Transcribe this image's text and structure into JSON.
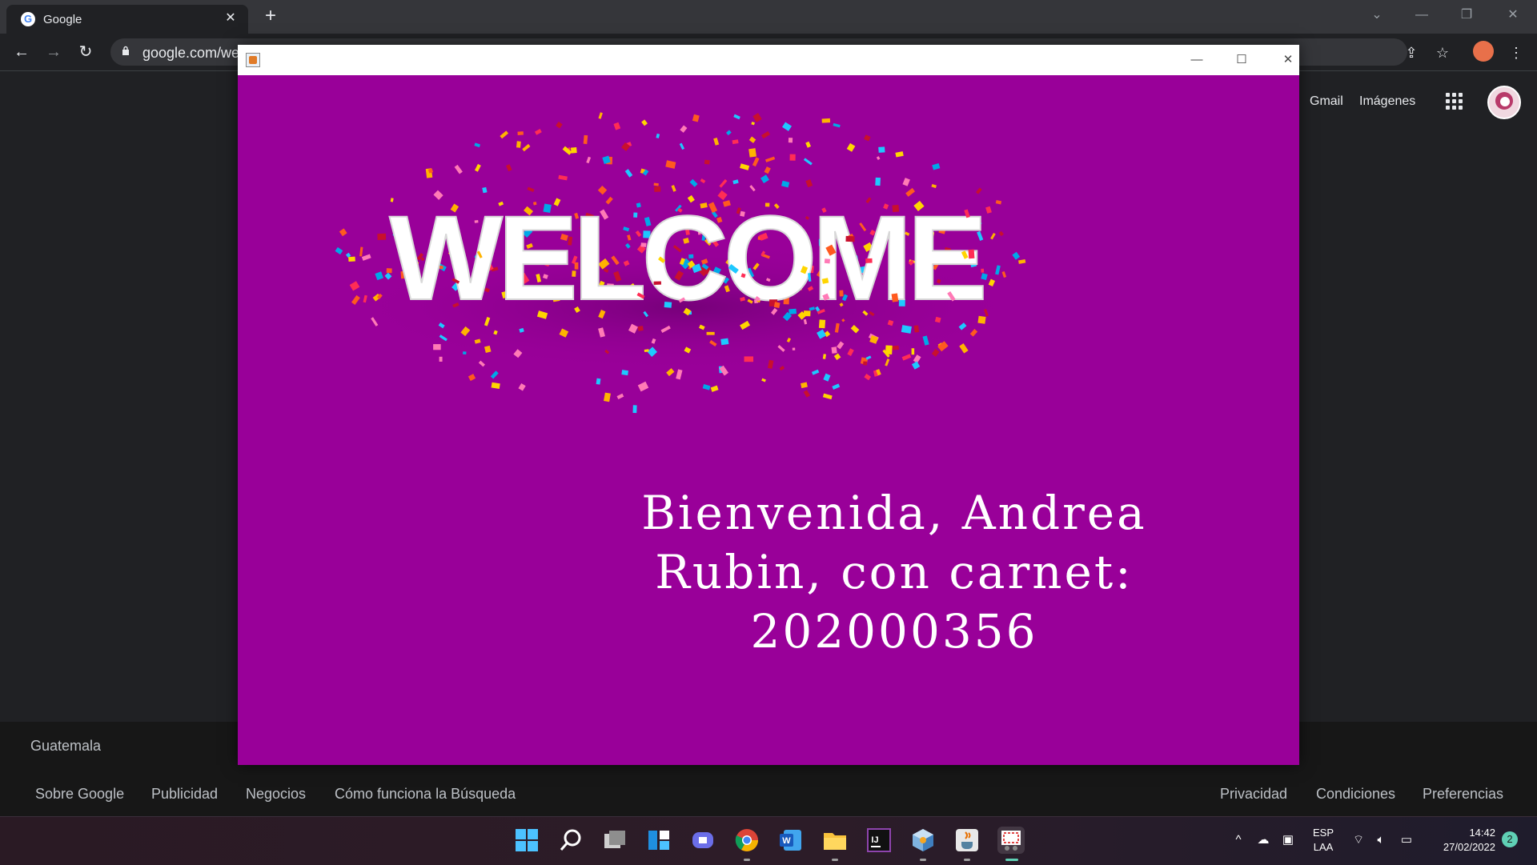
{
  "browser": {
    "tab_title": "Google",
    "url": "google.com/we",
    "new_tab_symbol": "+",
    "close_tab_symbol": "✕"
  },
  "google": {
    "links": [
      "Gmail",
      "Imágenes"
    ],
    "country": "Guatemala",
    "footer_left": [
      "Sobre Google",
      "Publicidad",
      "Negocios",
      "Cómo funciona la Búsqueda"
    ],
    "footer_right": [
      "Privacidad",
      "Condiciones",
      "Preferencias"
    ]
  },
  "dialog": {
    "welcome_image_text": "WELCOME",
    "message_line1": "Bienvenida, Andrea",
    "message_line2": "Rubin, con carnet:",
    "message_line3": "202000356",
    "background_color": "#990099"
  },
  "taskbar": {
    "apps": [
      "start-icon",
      "search-icon",
      "task-view-icon",
      "widgets-icon",
      "teams-chat-icon",
      "chrome-icon",
      "word-icon",
      "file-explorer-icon",
      "intellij-icon",
      "app-cube-icon",
      "java-icon",
      "snipping-tool-icon"
    ],
    "lang_top": "ESP",
    "lang_bottom": "LAA",
    "time": "14:42",
    "date": "27/02/2022",
    "notification_count": "2"
  }
}
